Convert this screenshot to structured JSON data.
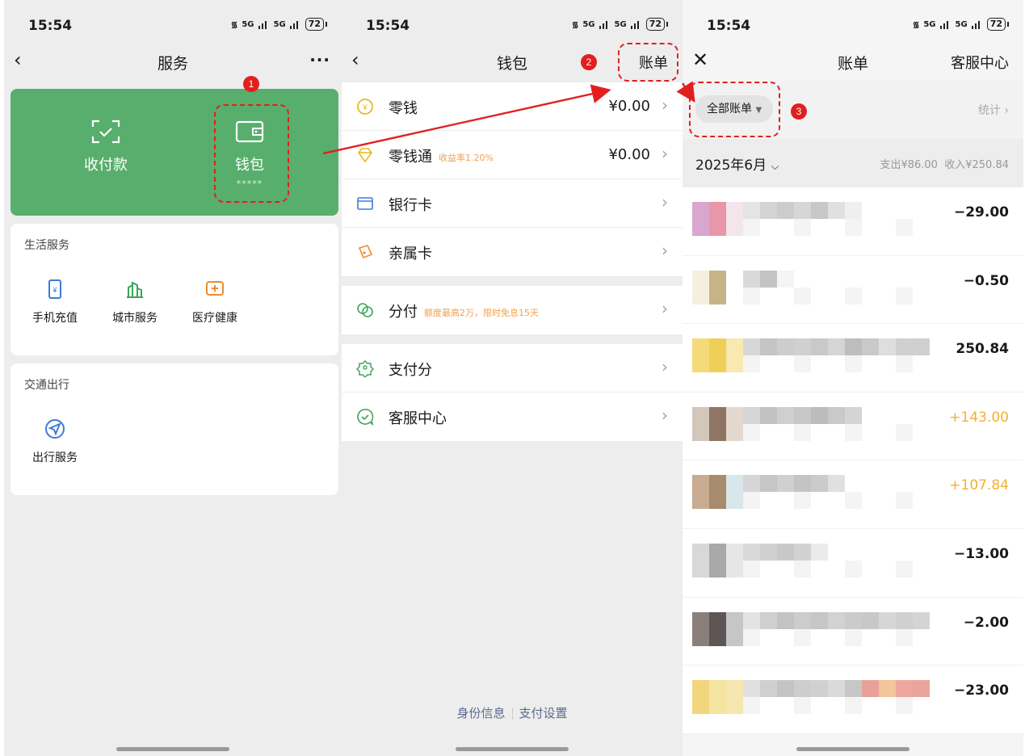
{
  "status": {
    "time": "15:54",
    "battery": "72",
    "net": "5G"
  },
  "p1": {
    "title": "服务",
    "more": "···",
    "receive_label": "收付款",
    "wallet_label": "钱包",
    "wallet_sub": "*****",
    "life_header": "生活服务",
    "life_items": [
      "手机充值",
      "城市服务",
      "医疗健康"
    ],
    "traffic_header": "交通出行",
    "traffic_items": [
      "出行服务"
    ]
  },
  "p2": {
    "title": "钱包",
    "bill_link": "账单",
    "rows": [
      {
        "label": "零钱",
        "tag": "",
        "value": "¥0.00"
      },
      {
        "label": "零钱通",
        "tag": "收益率1.20%",
        "value": "¥0.00"
      },
      {
        "label": "银行卡",
        "tag": "",
        "value": ""
      },
      {
        "label": "亲属卡",
        "tag": "",
        "value": ""
      },
      {
        "label": "分付",
        "tag": "额度最高2万，限时免息15天",
        "value": ""
      },
      {
        "label": "支付分",
        "tag": "",
        "value": ""
      },
      {
        "label": "客服中心",
        "tag": "",
        "value": ""
      }
    ],
    "footer": [
      "身份信息",
      "支付设置"
    ]
  },
  "p3": {
    "title": "账单",
    "right_link": "客服中心",
    "filter": "全部账单",
    "stats": "统计",
    "month": "2025年6月",
    "summary_out": "支出¥86.00",
    "summary_in": "收入¥250.84",
    "amounts": [
      "−29.00",
      "−0.50",
      "250.84",
      "+143.00",
      "+107.84",
      "−13.00",
      "−2.00",
      "−23.00"
    ]
  },
  "annotations": [
    "1",
    "2",
    "3"
  ],
  "colors": {
    "brand_green": "#58ae6c",
    "annotation_red": "#e21f1f",
    "income_yellow": "#f2b132"
  }
}
